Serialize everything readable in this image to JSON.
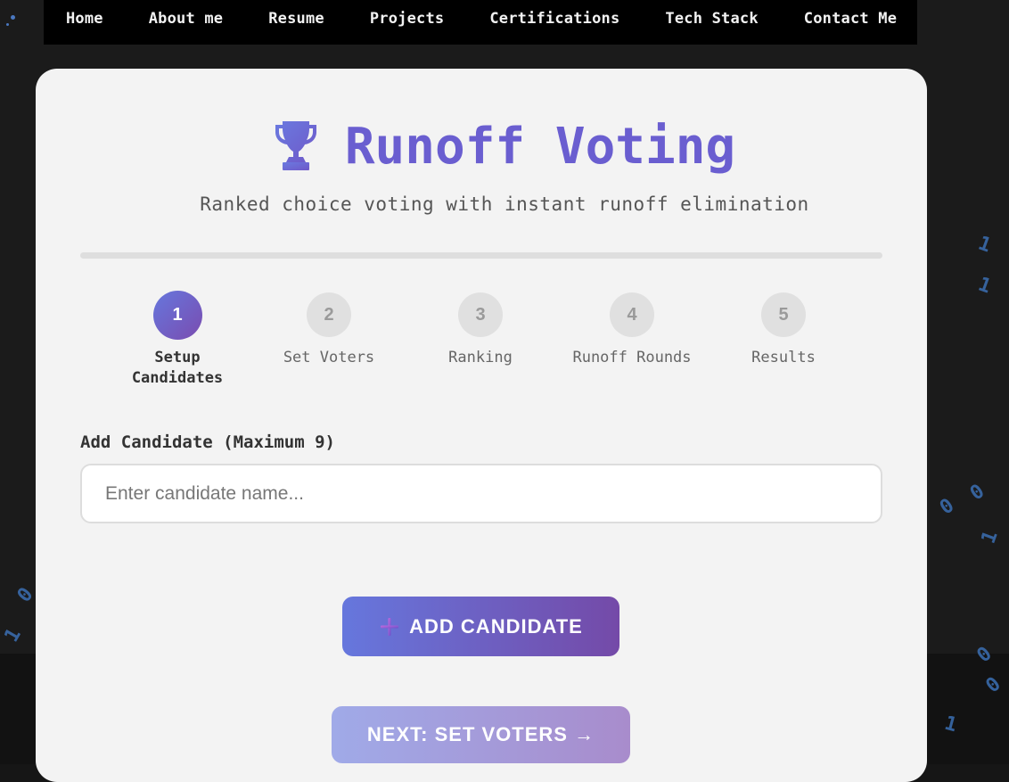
{
  "nav": {
    "items": [
      {
        "label": "Home"
      },
      {
        "label": "About me"
      },
      {
        "label": "Resume"
      },
      {
        "label": "Projects"
      },
      {
        "label": "Certifications"
      },
      {
        "label": "Tech Stack"
      },
      {
        "label": "Contact Me"
      }
    ]
  },
  "app": {
    "icon": "trophy-icon",
    "title": "Runoff Voting",
    "subtitle": "Ranked choice voting with instant runoff elimination",
    "progress_percent": 0
  },
  "steps": [
    {
      "number": "1",
      "label": "Setup Candidates",
      "active": true
    },
    {
      "number": "2",
      "label": "Set Voters",
      "active": false
    },
    {
      "number": "3",
      "label": "Ranking",
      "active": false
    },
    {
      "number": "4",
      "label": "Runoff Rounds",
      "active": false
    },
    {
      "number": "5",
      "label": "Results",
      "active": false
    }
  ],
  "form": {
    "label": "Add Candidate (Maximum 9)",
    "input_value": "",
    "input_placeholder": "Enter candidate name..."
  },
  "buttons": {
    "add_label": "ADD CANDIDATE",
    "add_icon": "plus-icon",
    "next_label": "NEXT: SET VOTERS →"
  },
  "background": {
    "digits": [
      "1",
      "1",
      "0",
      "0",
      "1",
      "0",
      "1",
      "0",
      "0",
      "1"
    ]
  },
  "colors": {
    "accent": "#6a5ed0",
    "accent_gradient_start": "#6677dd",
    "accent_gradient_end": "#744aa8",
    "nav_bg": "#000000",
    "card_bg": "#f3f3f3"
  }
}
